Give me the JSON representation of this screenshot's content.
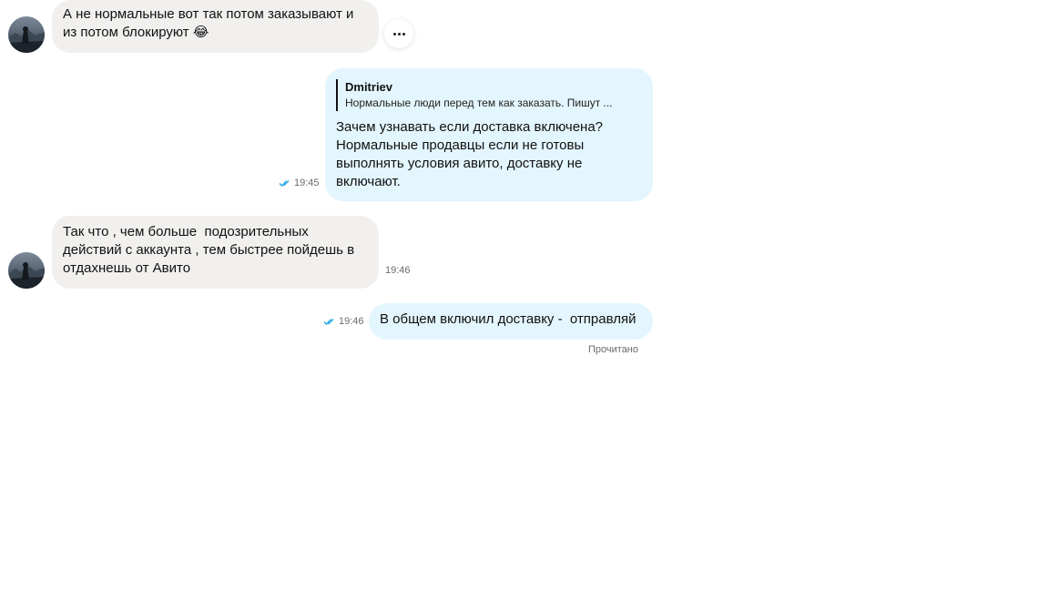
{
  "messages": [
    {
      "direction": "incoming",
      "text": "А не нормальные вот так потом заказывают и\nиз потом блокируют 😂",
      "time": ""
    },
    {
      "direction": "outgoing",
      "reply": {
        "author": "Dmitriev",
        "text": "Нормальные люди перед тем как заказать. Пишут ..."
      },
      "text": "Зачем узнавать если доставка включена?\nНормальные продавцы если не готовы\nвыполнять условия авито, доставку не\nвключают.",
      "time": "19:45"
    },
    {
      "direction": "incoming",
      "text": "Так что , чем больше  подозрительных\nдействий с аккаунта , тем быстрее пойдешь в\nотдахнешь от Авито",
      "time": "19:46"
    },
    {
      "direction": "outgoing",
      "text": "В общем включил доставку -  отправляй",
      "time": "19:46"
    }
  ],
  "read_status": "Прочитано",
  "icons": {
    "more": "more-dots-icon",
    "read": "double-check-icon"
  },
  "colors": {
    "incoming_bubble": "#f1f0ee",
    "outgoing_bubble": "#e3f5fd",
    "read_check": "#1aa3e8"
  }
}
